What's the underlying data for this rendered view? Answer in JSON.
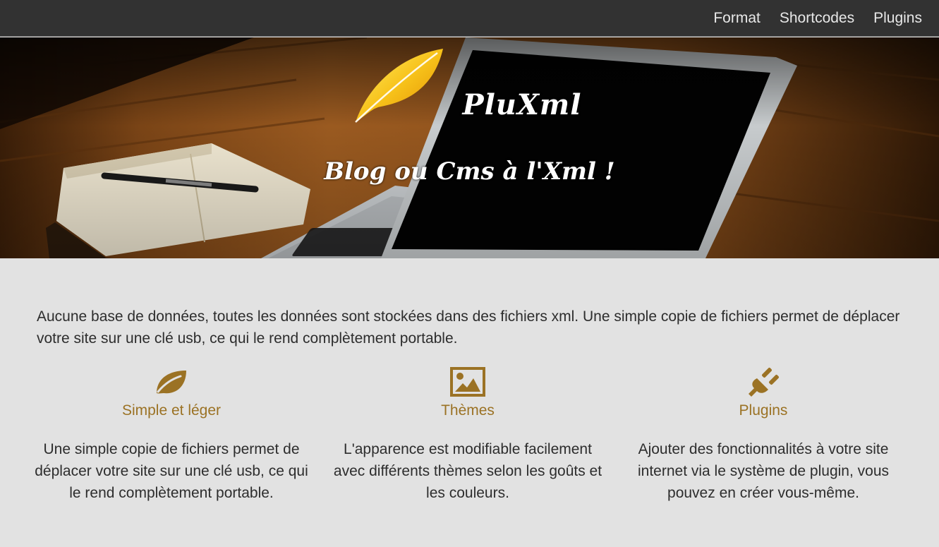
{
  "nav": {
    "items": [
      {
        "label": "Format"
      },
      {
        "label": "Shortcodes"
      },
      {
        "label": "Plugins"
      }
    ]
  },
  "hero": {
    "title": "PluXml",
    "subtitle": "Blog ou Cms à l'Xml !",
    "logo_icon": "leaf-logo-icon"
  },
  "intro": {
    "text": "Aucune base de données, toutes les données sont stockées dans des fichiers xml. Une simple copie de fichiers permet de déplacer votre site sur une clé usb, ce qui le rend complètement portable."
  },
  "features": [
    {
      "icon": "leaf-icon",
      "title": "Simple et léger",
      "text": "Une simple copie de fichiers permet de déplacer votre site sur une clé usb, ce qui le rend complètement portable."
    },
    {
      "icon": "image-icon",
      "title": "Thèmes",
      "text": "L'apparence est modifiable facilement avec différents thèmes selon les goûts et les couleurs."
    },
    {
      "icon": "plug-icon",
      "title": "Plugins",
      "text": "Ajouter des fonctionnalités à votre site internet via le système de plugin, vous pouvez en créer vous-même."
    }
  ],
  "colors": {
    "navbar": "#323232",
    "accent": "#9b7224",
    "page_background": "#e2e2e2",
    "body_text": "#2d2d2d"
  }
}
